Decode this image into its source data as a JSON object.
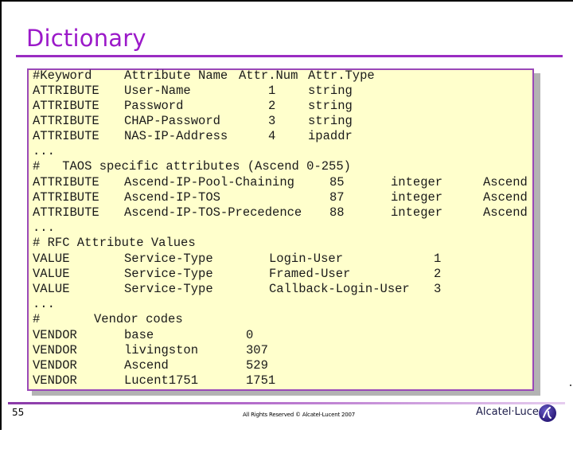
{
  "slide": {
    "title": "Dictionary",
    "page_number": "55",
    "copyright": "All Rights Reserved © Alcatel-Lucent 2007",
    "brand": "Alcatel·Lucent",
    "logo_icon": "alcatel-lucent-logo-icon",
    "colors": {
      "title": "#9b19c9",
      "rule": "#9a2cc2",
      "box_background": "#ffffcc",
      "box_border": "#9a48b8",
      "shadow": "#b3b3b3"
    }
  },
  "dictionary": {
    "header": {
      "keyword": "#Keyword",
      "name": "Attribute Name",
      "num": "Attr.Num",
      "type": "Attr.Type"
    },
    "rfc_attributes": [
      {
        "keyword": "ATTRIBUTE",
        "name": "User-Name",
        "num": "1",
        "type": "string"
      },
      {
        "keyword": "ATTRIBUTE",
        "name": "Password",
        "num": "2",
        "type": "string"
      },
      {
        "keyword": "ATTRIBUTE",
        "name": "CHAP-Password",
        "num": "3",
        "type": "string"
      },
      {
        "keyword": "ATTRIBUTE",
        "name": "NAS-IP-Address",
        "num": "4",
        "type": "ipaddr"
      }
    ],
    "ellipsis_1": "...",
    "taos_comment": "#   TAOS specific attributes (Ascend 0-255)",
    "taos_attributes": [
      {
        "keyword": "ATTRIBUTE",
        "name": "Ascend-IP-Pool-Chaining",
        "num": "85",
        "type": "integer",
        "vendor": "Ascend"
      },
      {
        "keyword": "ATTRIBUTE",
        "name": "Ascend-IP-TOS",
        "num": "87",
        "type": "integer",
        "vendor": "Ascend"
      },
      {
        "keyword": "ATTRIBUTE",
        "name": "Ascend-IP-TOS-Precedence",
        "num": "88",
        "type": "integer",
        "vendor": "Ascend"
      }
    ],
    "ellipsis_2": "...",
    "values_comment": "# RFC Attribute Values",
    "values": [
      {
        "keyword": "VALUE",
        "attribute": "Service-Type",
        "name": "Login-User",
        "num": "1"
      },
      {
        "keyword": "VALUE",
        "attribute": "Service-Type",
        "name": "Framed-User",
        "num": "2"
      },
      {
        "keyword": "VALUE",
        "attribute": "Service-Type",
        "name": "Callback-Login-User",
        "num": "3"
      }
    ],
    "ellipsis_3": "...",
    "vendor_comment_hash": "#",
    "vendor_comment_text": "Vendor codes",
    "vendors": [
      {
        "keyword": "VENDOR",
        "name": "base",
        "code": "0"
      },
      {
        "keyword": "VENDOR",
        "name": "livingston",
        "code": "307"
      },
      {
        "keyword": "VENDOR",
        "name": "Ascend",
        "code": "529"
      },
      {
        "keyword": "VENDOR",
        "name": "Lucent1751",
        "code": "1751"
      }
    ]
  }
}
